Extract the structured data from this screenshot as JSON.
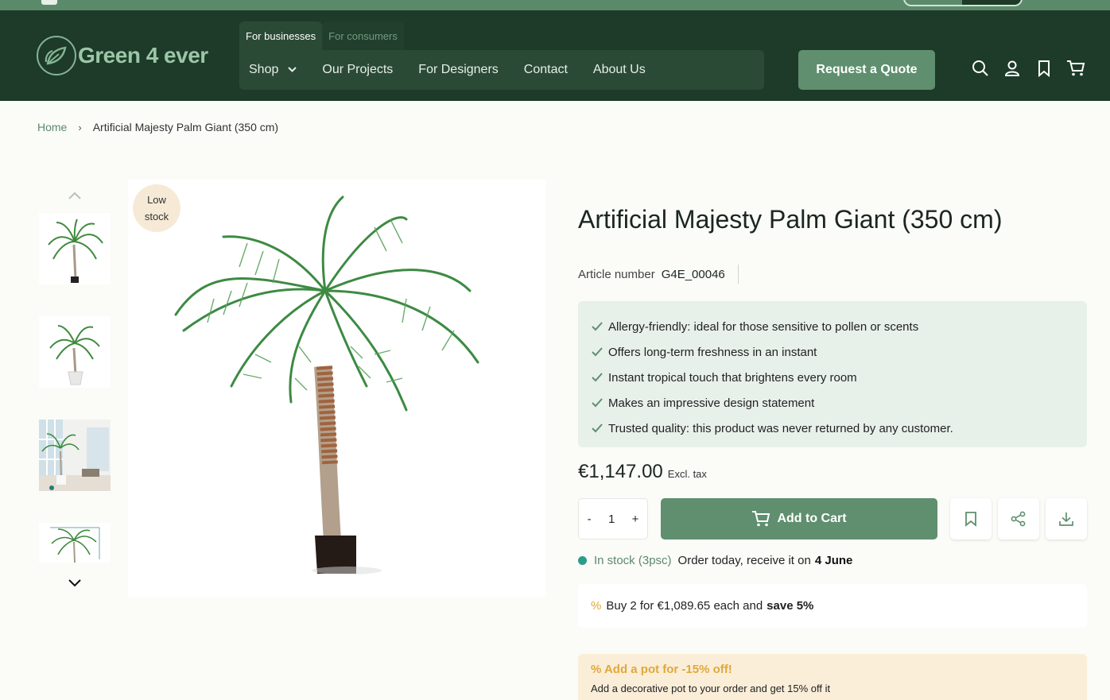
{
  "header": {
    "logo_text": "Green 4 ever",
    "audience_tabs": [
      "For businesses",
      "For consumers"
    ],
    "nav": {
      "shop": "Shop",
      "projects": "Our Projects",
      "designers": "For Designers",
      "contact": "Contact",
      "about": "About Us"
    },
    "quote_button": "Request a Quote",
    "icons": [
      "search-icon",
      "account-icon",
      "bookmark-icon",
      "cart-icon"
    ]
  },
  "breadcrumb": {
    "home": "Home",
    "separator": "›",
    "current": "Artificial Majesty Palm Giant (350 cm)"
  },
  "gallery": {
    "badge_line1": "Low",
    "badge_line2": "stock"
  },
  "product": {
    "title": "Artificial Majesty Palm Giant (350 cm)",
    "article_label": "Article number",
    "article_number": "G4E_00046",
    "benefits": [
      "Allergy-friendly: ideal for those sensitive to pollen or scents",
      "Offers long-term freshness in an instant",
      "Instant tropical touch that brightens every room",
      "Makes an impressive design statement",
      "Trusted quality: this product was never returned by any customer."
    ],
    "price": "€1,147.00",
    "tax_note": "Excl. tax",
    "quantity": {
      "minus": "-",
      "value": "1",
      "plus": "+"
    },
    "add_to_cart": "Add to Cart",
    "stock_status": "In stock (3psc)",
    "order_text": "Order today, receive it on",
    "delivery_date": "4 June",
    "bulk_pct": "%",
    "bulk_text": "Buy 2 for €1,089.65 each and",
    "bulk_save": "save 5%",
    "pot_heading": "% Add a pot for -15% off!",
    "pot_desc": "Add a decorative pot to your order and get 15% off it"
  },
  "colors": {
    "header_bg": "#1d3b28",
    "accent_green": "#5f8f6e",
    "benefit_bg": "#e8f0ea",
    "stock_dot": "#2a9d8a",
    "promo_orange": "#e0a83b",
    "promo_bg": "#fbeed8"
  }
}
